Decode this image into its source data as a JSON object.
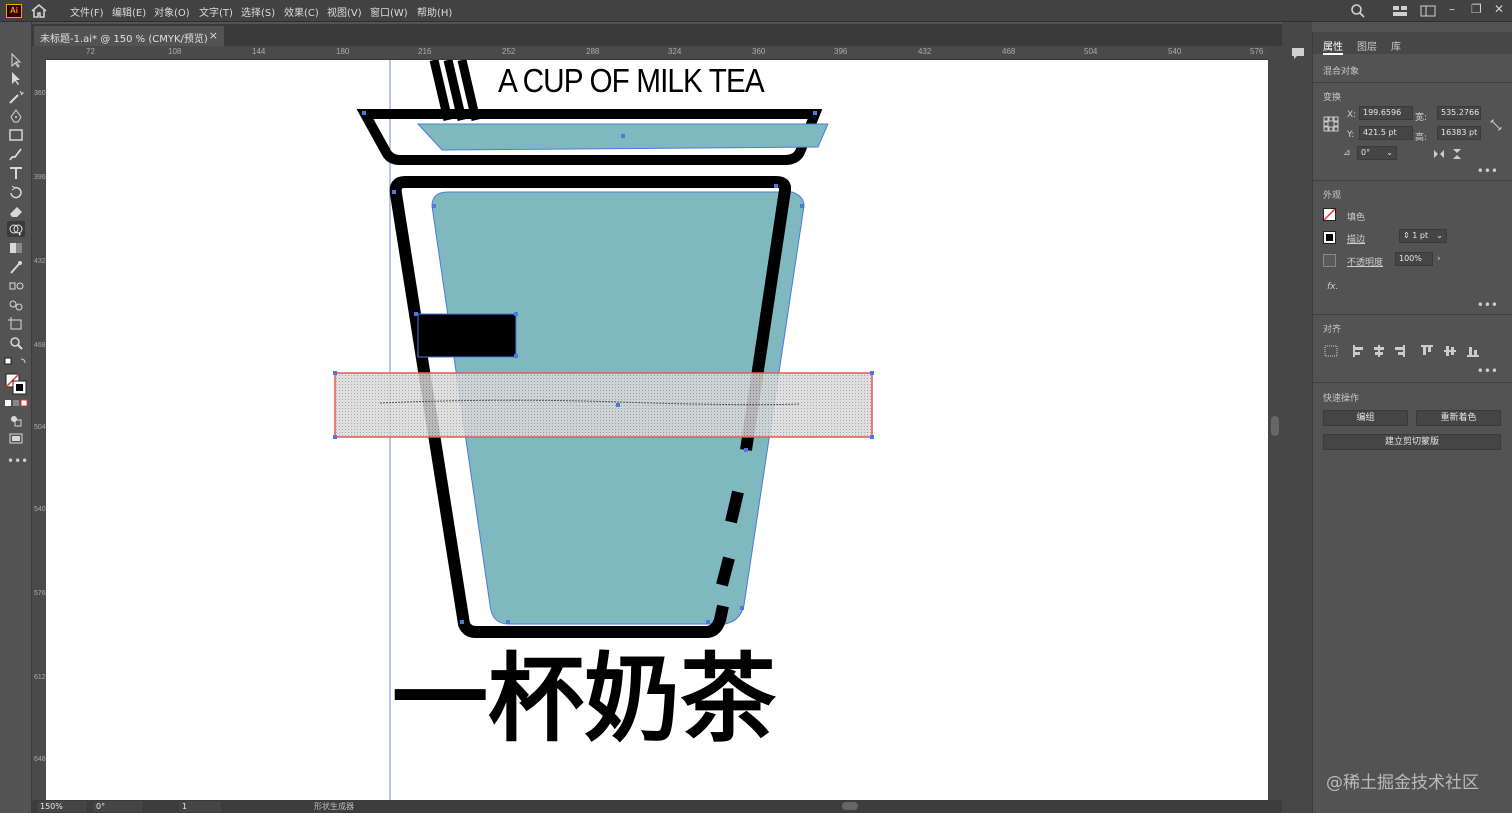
{
  "app": {
    "logo_text": "Ai",
    "accent": "#ff9a00"
  },
  "menu": [
    "文件(F)",
    "编辑(E)",
    "对象(O)",
    "文字(T)",
    "选择(S)",
    "效果(C)",
    "视图(V)",
    "窗口(W)",
    "帮助(H)"
  ],
  "document": {
    "tab_label": "未标题-1.ai* @ 150 % (CMYK/预览)",
    "close_glyph": "×"
  },
  "rulers": {
    "horizontal": [
      "72",
      "108",
      "144",
      "180",
      "216",
      "252",
      "288",
      "324",
      "360",
      "396",
      "432",
      "468",
      "504",
      "540",
      "576"
    ],
    "vertical": [
      "360",
      "396",
      "432",
      "468",
      "504",
      "540",
      "576",
      "612",
      "648"
    ]
  },
  "artwork": {
    "title_text": "A CUP OF MILK TEA",
    "chinese_title": "一杯奶茶",
    "cup_fill": "#80b8bf",
    "stroke": "#000000",
    "selection": "#4a7bdc",
    "blend_border": "#e25858"
  },
  "status": {
    "zoom": "150%",
    "rotation": "0°",
    "page": "1",
    "tool_name": "形状生成器"
  },
  "panel": {
    "tabs": [
      "属性",
      "图层",
      "库"
    ],
    "object_type": "混合对象",
    "transform": {
      "title": "变换",
      "x_label": "X:",
      "x": "199.6596",
      "y_label": "Y:",
      "y": "421.5 pt",
      "w_label": "宽:",
      "w": "535.2766",
      "h_label": "高:",
      "h": "16383 pt",
      "angle": "0°"
    },
    "appearance": {
      "title": "外观",
      "fill_label": "填色",
      "stroke_label": "描边",
      "stroke_weight": "1 pt",
      "opacity_label": "不透明度",
      "opacity": "100%",
      "fx": "fx."
    },
    "align_title": "对齐",
    "quick": {
      "title": "快速操作",
      "group_button": "编组",
      "recolor_button": "重新着色",
      "clip_button": "建立剪切蒙版"
    }
  },
  "watermark": "@稀土掘金技术社区"
}
